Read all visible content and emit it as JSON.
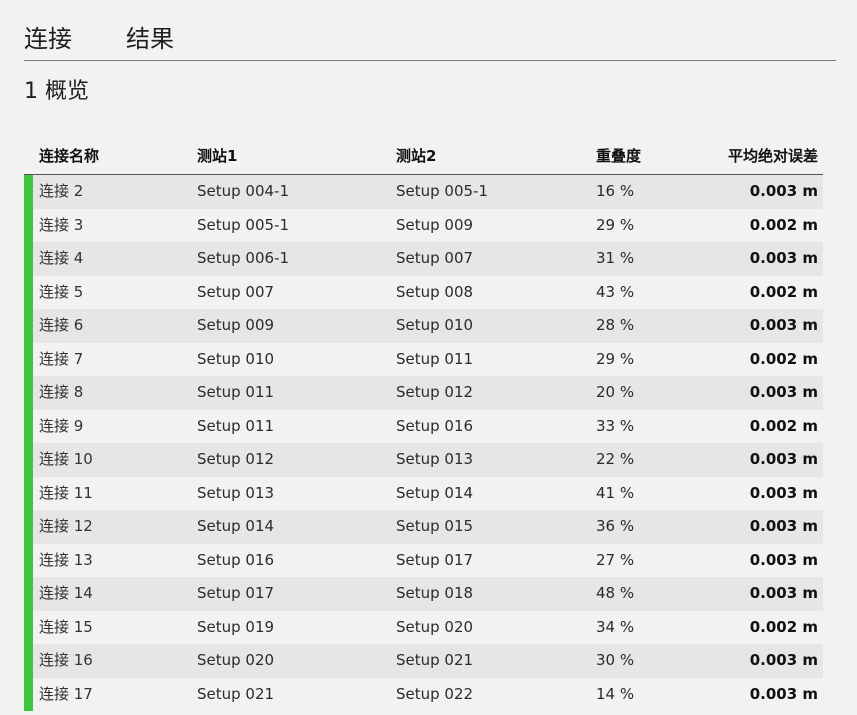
{
  "tabs": [
    {
      "label": "连接"
    },
    {
      "label": "结果"
    }
  ],
  "section": {
    "title": "1 概览"
  },
  "table": {
    "headers": {
      "name": "连接名称",
      "station1": "测站1",
      "station2": "测站2",
      "overlap": "重叠度",
      "mae": "平均绝对误差"
    },
    "rows": [
      {
        "name": "连接 2",
        "station1": "Setup 004-1",
        "station2": "Setup 005-1",
        "overlap": "16 %",
        "mae": "0.003 m"
      },
      {
        "name": "连接 3",
        "station1": "Setup 005-1",
        "station2": "Setup 009",
        "overlap": "29 %",
        "mae": "0.002 m"
      },
      {
        "name": "连接 4",
        "station1": "Setup 006-1",
        "station2": "Setup 007",
        "overlap": "31 %",
        "mae": "0.003 m"
      },
      {
        "name": "连接 5",
        "station1": "Setup 007",
        "station2": "Setup 008",
        "overlap": "43 %",
        "mae": "0.002 m"
      },
      {
        "name": "连接 6",
        "station1": "Setup 009",
        "station2": "Setup 010",
        "overlap": "28 %",
        "mae": "0.003 m"
      },
      {
        "name": "连接 7",
        "station1": "Setup 010",
        "station2": "Setup 011",
        "overlap": "29 %",
        "mae": "0.002 m"
      },
      {
        "name": "连接 8",
        "station1": "Setup 011",
        "station2": "Setup 012",
        "overlap": "20 %",
        "mae": "0.003 m"
      },
      {
        "name": "连接 9",
        "station1": "Setup 011",
        "station2": "Setup 016",
        "overlap": "33 %",
        "mae": "0.002 m"
      },
      {
        "name": "连接 10",
        "station1": "Setup 012",
        "station2": "Setup 013",
        "overlap": "22 %",
        "mae": "0.003 m"
      },
      {
        "name": "连接 11",
        "station1": "Setup 013",
        "station2": "Setup 014",
        "overlap": "41 %",
        "mae": "0.003 m"
      },
      {
        "name": "连接 12",
        "station1": "Setup 014",
        "station2": "Setup 015",
        "overlap": "36 %",
        "mae": "0.003 m"
      },
      {
        "name": "连接 13",
        "station1": "Setup 016",
        "station2": "Setup 017",
        "overlap": "27 %",
        "mae": "0.003 m"
      },
      {
        "name": "连接 14",
        "station1": "Setup 017",
        "station2": "Setup 018",
        "overlap": "48 %",
        "mae": "0.003 m"
      },
      {
        "name": "连接 15",
        "station1": "Setup 019",
        "station2": "Setup 020",
        "overlap": "34 %",
        "mae": "0.002 m"
      },
      {
        "name": "连接 16",
        "station1": "Setup 020",
        "station2": "Setup 021",
        "overlap": "30 %",
        "mae": "0.003 m"
      },
      {
        "name": "连接 17",
        "station1": "Setup 021",
        "station2": "Setup 022",
        "overlap": "14 %",
        "mae": "0.003 m"
      }
    ]
  },
  "colors": {
    "row_status_bar": "#3ec63e",
    "row_alt_bg": "#e6e6e6",
    "page_bg": "#f2f2f2"
  }
}
